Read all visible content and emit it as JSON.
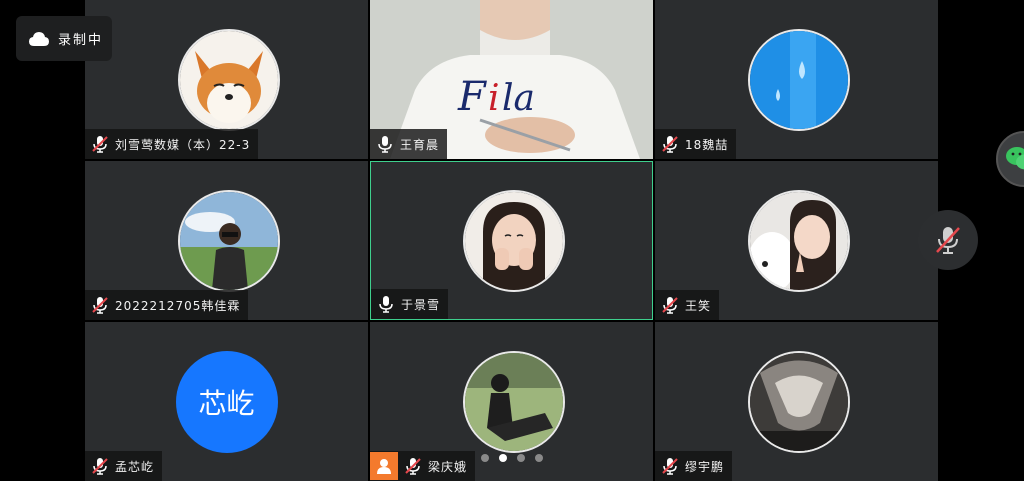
{
  "recording": {
    "label": "录制中",
    "icon": "cloud-icon"
  },
  "pagination": {
    "total": 4,
    "current": 1
  },
  "floating": {
    "wechat_icon": "wechat-icon",
    "mic_icon": "mic-muted-icon"
  },
  "colors": {
    "active_border": "#3fcf8e",
    "mic_muted": "#e5484d",
    "tile_bg": "#2b2d2f",
    "badge_orange": "#f47a2d",
    "text_avatar_blue": "#1677ff"
  },
  "participants": [
    {
      "name": "刘雪莺数媒（本）22-3",
      "mic": "muted",
      "avatar": "fox"
    },
    {
      "name": "王育晨",
      "mic": "on",
      "avatar": "video"
    },
    {
      "name": "18魏喆",
      "mic": "muted",
      "avatar": "water-blue"
    },
    {
      "name": "2022212705韩佳霖",
      "mic": "muted",
      "avatar": "girl-landscape"
    },
    {
      "name": "于景雪",
      "mic": "on",
      "avatar": "girl-smile",
      "active": true
    },
    {
      "name": "王笑",
      "mic": "muted",
      "avatar": "girl-dog"
    },
    {
      "name": "孟芯屹",
      "mic": "muted",
      "avatar": "text",
      "avatar_text": "芯屹"
    },
    {
      "name": "梁庆娥",
      "mic": "muted",
      "avatar": "girl-park",
      "badge": "user-icon"
    },
    {
      "name": "缪宇鹏",
      "mic": "muted",
      "avatar": "dark-abstract"
    }
  ]
}
